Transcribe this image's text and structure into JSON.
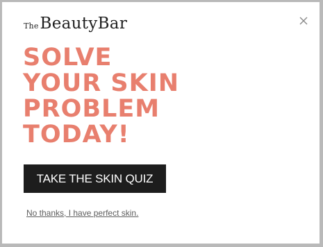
{
  "brand": {
    "prefix": "The",
    "name": "BeautyBar"
  },
  "close": {
    "icon": "close-icon"
  },
  "headline": {
    "lines": [
      "SOLVE",
      "YOUR SKIN",
      "PROBLEM",
      "TODAY!"
    ],
    "color": "#e87f6e"
  },
  "cta": {
    "label": "TAKE THE SKIN QUIZ",
    "background": "#1d1d1d"
  },
  "decline": {
    "label": "No thanks, I have perfect skin."
  }
}
